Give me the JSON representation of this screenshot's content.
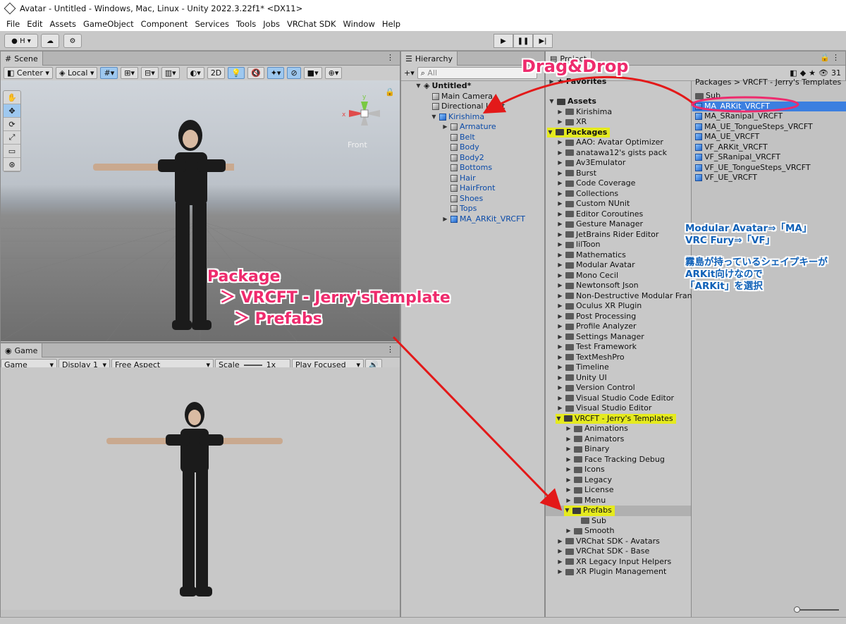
{
  "window_title": "Avatar - Untitled - Windows, Mac, Linux - Unity 2022.3.22f1* <DX11>",
  "menu": [
    "File",
    "Edit",
    "Assets",
    "GameObject",
    "Component",
    "Services",
    "Tools",
    "Jobs",
    "VRChat SDK",
    "Window",
    "Help"
  ],
  "toolbar": {
    "account": "H"
  },
  "scene": {
    "tab": "Scene",
    "pivot": "Center",
    "space": "Local",
    "mode_2d": "2D",
    "front_label": "Front"
  },
  "game": {
    "tab": "Game",
    "mode": "Game",
    "display": "Display 1",
    "aspect": "Free Aspect",
    "scale_label": "Scale",
    "scale_value": "1x",
    "play_mode": "Play Focused"
  },
  "hierarchy": {
    "tab": "Hierarchy",
    "search_placeholder": "All",
    "scene_name": "Untitled*",
    "items": [
      "Main Camera",
      "Directional Light",
      "Kirishima",
      "Armature",
      "Belt",
      "Body",
      "Body2",
      "Bottoms",
      "Hair",
      "HairFront",
      "Shoes",
      "Tops",
      "MA_ARKit_VRCFT"
    ]
  },
  "project": {
    "tab": "Project",
    "hidden_count": "31",
    "favorites": "Favorites",
    "assets": "Assets",
    "asset_children": [
      "Kirishima",
      "XR"
    ],
    "packages": "Packages",
    "package_list": [
      "AAO: Avatar Optimizer",
      "anatawa12's gists pack",
      "Av3Emulator",
      "Burst",
      "Code Coverage",
      "Collections",
      "Custom NUnit",
      "Editor Coroutines",
      "Gesture Manager",
      "JetBrains Rider Editor",
      "lilToon",
      "Mathematics",
      "Modular Avatar",
      "Mono Cecil",
      "Newtonsoft Json",
      "Non-Destructive Modular Fran",
      "Oculus XR Plugin",
      "Post Processing",
      "Profile Analyzer",
      "Settings Manager",
      "Test Framework",
      "TextMeshPro",
      "Timeline",
      "Unity UI",
      "Version Control",
      "Visual Studio Code Editor",
      "Visual Studio Editor"
    ],
    "vrcft": "VRCFT - Jerry's Templates",
    "vrcft_children": [
      "Animations",
      "Animators",
      "Binary",
      "Face Tracking Debug",
      "Icons",
      "Legacy",
      "License",
      "Menu"
    ],
    "prefabs": "Prefabs",
    "prefabs_sub": "Sub",
    "smooth": "Smooth",
    "package_tail": [
      "VRChat SDK - Avatars",
      "VRChat SDK - Base",
      "XR Legacy Input Helpers",
      "XR Plugin Management"
    ],
    "breadcrumb": "Packages  >  VRCFT - Jerry's Templates",
    "files": [
      "Sub",
      "MA_ARKit_VRCFT",
      "MA_SRanipal_VRCFT",
      "MA_UE_TongueSteps_VRCFT",
      "MA_UE_VRCFT",
      "VF_ARKit_VRCFT",
      "VF_SRanipal_VRCFT",
      "VF_UE_TongueSteps_VRCFT",
      "VF_UE_VRCFT"
    ]
  },
  "annotations": {
    "drag_drop": "Drag&Drop",
    "path_line1": "Package",
    "path_line2": "＞ VRCFT - Jerry'sTemplate",
    "path_line3": "＞ Prefabs",
    "note1": "Modular Avatar⇒「MA」",
    "note2": "VRC Fury⇒「VF」",
    "note3": "霧島が持っているシェイプキーが",
    "note4": "ARKit向けなので",
    "note5": "「ARKit」を選択"
  },
  "colors": {
    "annotation_pink": "#ee2b6d",
    "annotation_blue": "#1061b8",
    "arrow_red": "#e31919",
    "selection": "#3b7fe0"
  }
}
